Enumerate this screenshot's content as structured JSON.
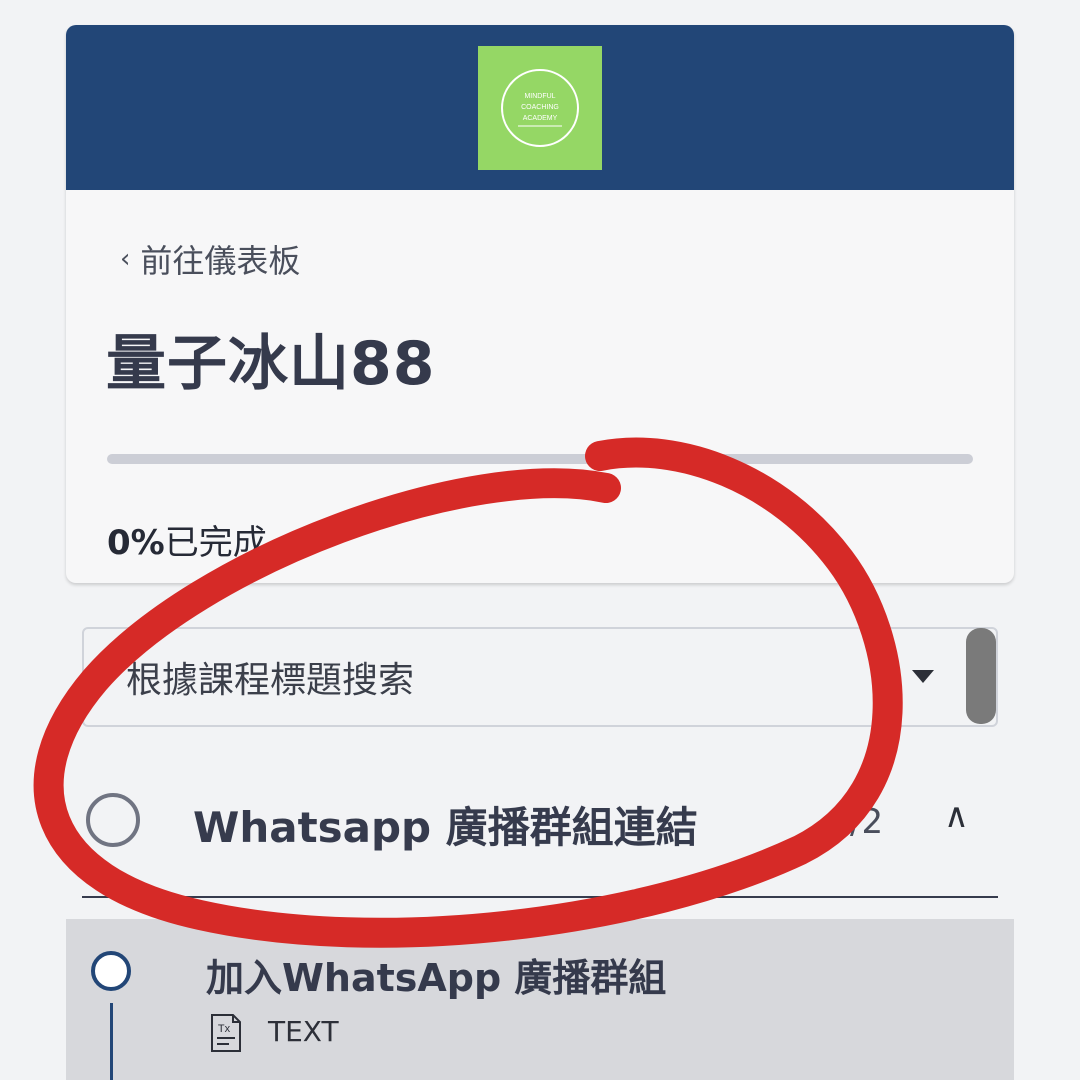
{
  "header": {
    "logo_text": [
      "MINDFUL",
      "COACHING",
      "ACADEMY"
    ],
    "banner_color": "#224677",
    "logo_color": "#95d765"
  },
  "nav": {
    "back_icon": "chevron-left-icon",
    "back_label": "前往儀表板"
  },
  "course": {
    "title": "量子冰山88",
    "progress_percent": 0,
    "progress_value": "0%",
    "progress_suffix": "已完成"
  },
  "search": {
    "placeholder": "根據課程標題搜索",
    "dropdown_icon": "caret-down-icon"
  },
  "section": {
    "title": "Whatsapp 廣播群組連結",
    "count": "/2",
    "toggle_icon": "chevron-up-icon"
  },
  "lessons": [
    {
      "title": "加入WhatsApp 廣播群組",
      "type": "TEXT",
      "type_icon": "text-document-icon"
    }
  ],
  "colors": {
    "accent": "#224677",
    "annotation": "#d62a27"
  }
}
